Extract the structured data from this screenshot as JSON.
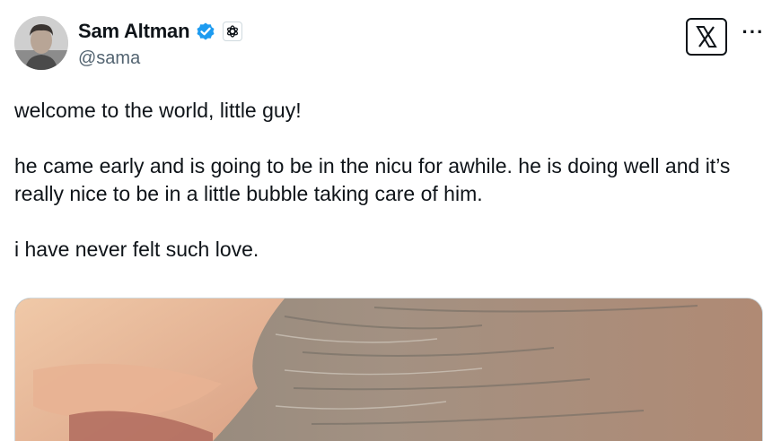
{
  "author": {
    "display_name": "Sam Altman",
    "handle": "@sama",
    "verified_icon": "verified-badge-icon",
    "affiliate_icon": "openai-logo-icon",
    "avatar_alt": "profile photo"
  },
  "header": {
    "platform_logo": "x-logo-icon",
    "more_label": "···"
  },
  "tweet": {
    "paragraphs": [
      "welcome to the world, little guy!",
      "he came early and is going to be in the nicu for awhile. he is doing well and it’s really nice to be in a little bubble taking care of him.",
      "i have never felt such love."
    ]
  },
  "media": {
    "description": "photo attachment"
  },
  "colors": {
    "text": "#0f1419",
    "secondary": "#536471",
    "verified_blue": "#1d9bf0",
    "border": "#cfd9de"
  }
}
